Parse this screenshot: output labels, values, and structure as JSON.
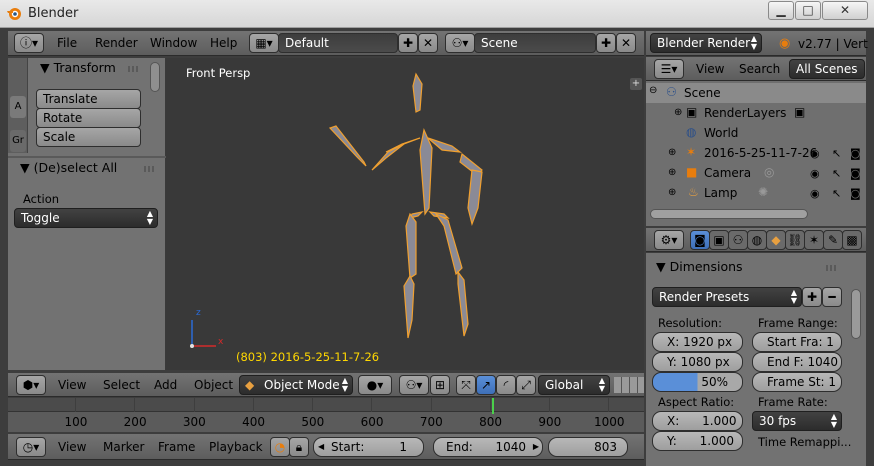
{
  "window": {
    "title": "Blender",
    "minimize": "▁",
    "maximize": "□",
    "close": "✕"
  },
  "info_header": {
    "menus": [
      "File",
      "Render",
      "Window",
      "Help"
    ],
    "screen_layout": "Default",
    "scene": "Scene",
    "render_engine": "Blender Render",
    "version_text": "v2.77 | Vert"
  },
  "toolshelf": {
    "tabs": [
      "A",
      "Gr"
    ],
    "transform_header": "Transform",
    "buttons": [
      "Translate",
      "Rotate",
      "Scale"
    ],
    "operator_header": "(De)select All",
    "action_label": "Action",
    "action_value": "Toggle"
  },
  "viewport": {
    "view_label": "Front Persp",
    "object_label": "(803) 2016-5-25-11-7-26",
    "axis_z": "z",
    "axis_x": "x"
  },
  "view3d_header": {
    "menus": [
      "View",
      "Select",
      "Add",
      "Object"
    ],
    "mode": "Object Mode",
    "orientation": "Global"
  },
  "timeline": {
    "ticks": [
      "100",
      "200",
      "300",
      "400",
      "500",
      "600",
      "700",
      "800",
      "900",
      "1000"
    ],
    "current_frame_value": 803,
    "frame_end_value": 1040
  },
  "timeline_header": {
    "menus": [
      "View",
      "Marker",
      "Frame",
      "Playback"
    ],
    "start_label": "Start:",
    "start_value": "1",
    "end_label": "End:",
    "end_value": "1040",
    "current_frame": "803"
  },
  "outliner": {
    "menus": [
      "View",
      "Search"
    ],
    "display_mode": "All Scenes",
    "items": [
      {
        "label": "Scene",
        "icon": "scene-icon"
      },
      {
        "label": "RenderLayers",
        "icon": "renderlayers-icon"
      },
      {
        "label": "World",
        "icon": "world-icon"
      },
      {
        "label": "2016-5-25-11-7-26",
        "icon": "armature-icon"
      },
      {
        "label": "Camera",
        "icon": "camera-icon"
      },
      {
        "label": "Lamp",
        "icon": "lamp-icon"
      }
    ]
  },
  "properties": {
    "panel": "Dimensions",
    "render_presets": "Render Presets",
    "resolution_label": "Resolution:",
    "res_x": "X: 1920 px",
    "res_y": "Y: 1080 px",
    "res_percent": "50%",
    "frame_range_label": "Frame Range:",
    "start_frame": "Start Fra:  1",
    "end_frame": "End F: 1040",
    "frame_step": "Frame St:  1",
    "aspect_label": "Aspect Ratio:",
    "aspect_x": "X:      1.000",
    "aspect_y": "Y:      1.000",
    "frame_rate_label": "Frame Rate:",
    "fps": "30 fps",
    "time_remap_label": "Time Remappi..."
  },
  "colors": {
    "accent_orange": "#f0a030",
    "playhead_green": "#4bd04b",
    "label_yellow": "#ffd700"
  }
}
